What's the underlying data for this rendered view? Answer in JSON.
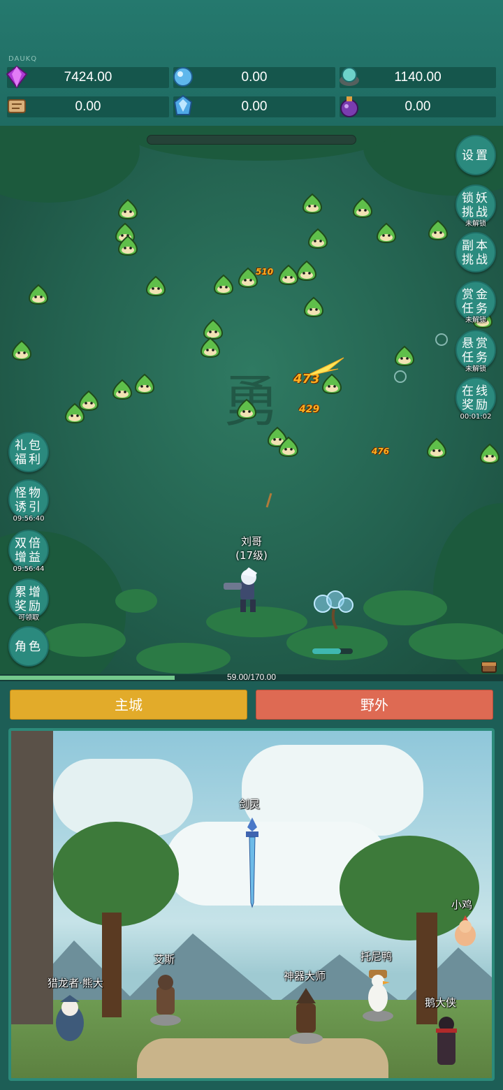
{
  "tag": "DAUKQ",
  "resources": [
    {
      "icon": "purple-gem-icon",
      "value": "7424.00"
    },
    {
      "icon": "blue-crystal-icon",
      "value": "0.00"
    },
    {
      "icon": "orb-icon",
      "value": "1140.00"
    },
    {
      "icon": "scroll-icon",
      "value": "0.00"
    },
    {
      "icon": "ice-crystal-icon",
      "value": "0.00"
    },
    {
      "icon": "potion-icon",
      "value": "0.00"
    }
  ],
  "right_menu": {
    "settings": "设置",
    "lock_demon": "锁妖\n挑战",
    "lock_demon_sub": "未解锁",
    "dungeon": "副本\n挑战",
    "bounty_gold": "赏金\n任务",
    "bounty_gold_sub": "未解锁",
    "bounty_task": "悬赏\n任务",
    "bounty_task_sub": "未解锁",
    "online": "在线\n奖励",
    "online_sub": "00:01:02"
  },
  "left_menu": {
    "gift": "礼包\n福利",
    "lure": "怪物\n诱引",
    "lure_sub": "09:56:40",
    "double": "双倍\n增益",
    "double_sub": "09:56:44",
    "cumulative": "累增\n奖励",
    "cumulative_sub": "可领取",
    "role": "角色"
  },
  "player": {
    "name": "刘哥",
    "level": "(17级)"
  },
  "damage_numbers": [
    "510",
    "473",
    "429",
    "476"
  ],
  "watermark": "勇",
  "exp": {
    "text": "59.00/170.00",
    "current": 59,
    "max": 170
  },
  "tabs": {
    "main_city": "主城",
    "wild": "野外"
  },
  "npcs": {
    "sword_spirit": "剑灵",
    "chick": "小鸡",
    "ace": "艾斯",
    "tony_duck": "托尼鸭",
    "dragon_hunter": "猎龙者·熊大",
    "artifact_master": "神器大师",
    "goose_hero": "鹅大侠"
  },
  "colors": {
    "panel": "#1f6b62",
    "main_tab": "#e2ab2a",
    "wild_tab": "#de6a53",
    "button": "#2b8a7e"
  }
}
